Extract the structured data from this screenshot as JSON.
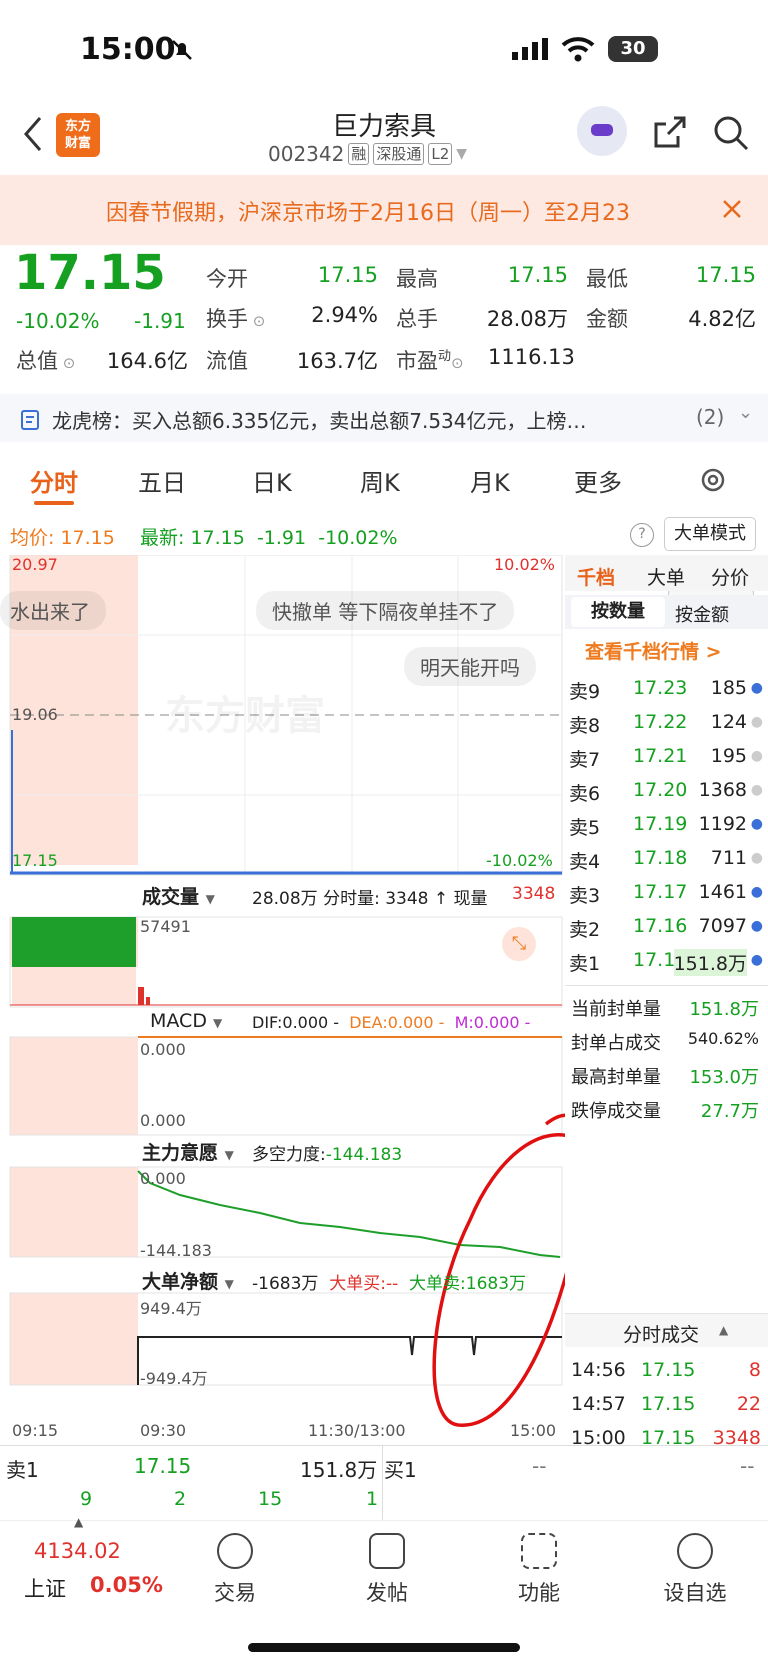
{
  "status_bar": {
    "time": "15:00",
    "battery": "30"
  },
  "header": {
    "title": "巨力索具",
    "code": "002342",
    "tags": [
      "融",
      "深股通",
      "L2"
    ],
    "logo_line1": "东方",
    "logo_line2": "财富"
  },
  "notice": {
    "text": "因春节假期，沪深京市场于2月16日（周一）至2月23"
  },
  "quote": {
    "price": "17.15",
    "change_pct": "-10.02%",
    "change": "-1.91",
    "open_label": "今开",
    "open": "17.15",
    "high_label": "最高",
    "high": "17.15",
    "low_label": "最低",
    "low": "17.15",
    "turnover_label": "换手",
    "turnover": "2.94%",
    "volume_label": "总手",
    "volume": "28.08万",
    "amount_label": "金额",
    "amount": "4.82亿",
    "mktcap_label": "总值",
    "mktcap": "164.6亿",
    "float_label": "流值",
    "float": "163.7亿",
    "pe_label": "市盈",
    "pe_sup": "动",
    "pe": "1116.13",
    "more": "更多"
  },
  "lhb": {
    "text": "龙虎榜：买入总额6.335亿元，卖出总额7.534亿元，上榜…",
    "count": "(2)"
  },
  "tabs": [
    "分时",
    "五日",
    "日K",
    "周K",
    "月K",
    "更多"
  ],
  "avg_bar": {
    "avg_label": "均价:",
    "avg": "17.15",
    "latest_label": "最新:",
    "latest": "17.15",
    "chg": "-1.91",
    "pct": "-10.02%",
    "mode": "大单模式"
  },
  "chart": {
    "top_price": "20.97",
    "top_pct": "10.02%",
    "mid_price": "19.06",
    "bot_price": "17.15",
    "bot_pct": "-10.02%",
    "watermark": "东方财富",
    "comments": [
      "水出来了",
      "快撤单 等下隔夜单挂不了",
      "明天能开吗"
    ],
    "vol_label": "成交量",
    "vol_info": "28.08万 分时量: 3348 ↑ 现量",
    "vol_now": "3348",
    "vol_max": "57491",
    "macd_label": "MACD",
    "dif": "DIF:0.000 -",
    "dea": "DEA:0.000 -",
    "m": "M:0.000 -",
    "macd_top": "0.000",
    "macd_bot": "0.000",
    "zl_label": "主力意愿",
    "zl_info_label": "多空力度:",
    "zl_info": "-144.183",
    "zl_top": "0.000",
    "zl_bot": "-144.183",
    "dd_label": "大单净额",
    "dd_val": "-1683万",
    "dd_buy": "大单买:--",
    "dd_sell": "大单卖:1683万",
    "dd_top": "949.4万",
    "dd_bot": "-949.4万",
    "times": [
      "09:15",
      "09:30",
      "11:30/13:00",
      "15:00"
    ]
  },
  "book": {
    "tabs": [
      "千档",
      "大单",
      "分价"
    ],
    "subtabs": [
      "按数量",
      "按金额"
    ],
    "link": "查看千档行情 >",
    "asks": [
      {
        "label": "卖9",
        "price": "17.23",
        "vol": "185"
      },
      {
        "label": "卖8",
        "price": "17.22",
        "vol": "124"
      },
      {
        "label": "卖7",
        "price": "17.21",
        "vol": "195"
      },
      {
        "label": "卖6",
        "price": "17.20",
        "vol": "1368"
      },
      {
        "label": "卖5",
        "price": "17.19",
        "vol": "1192"
      },
      {
        "label": "卖4",
        "price": "17.18",
        "vol": "711"
      },
      {
        "label": "卖3",
        "price": "17.17",
        "vol": "1461"
      },
      {
        "label": "卖2",
        "price": "17.16",
        "vol": "7097"
      },
      {
        "label": "卖1",
        "price": "17.15",
        "vol": "151.8万"
      }
    ],
    "stats": [
      {
        "label": "当前封单量",
        "value": "151.8万"
      },
      {
        "label": "封单占成交",
        "value": "540.62%"
      },
      {
        "label": "最高封单量",
        "value": "153.0万"
      },
      {
        "label": "跌停成交量",
        "value": "27.7万"
      }
    ],
    "trades_title": "分时成交",
    "trades": [
      {
        "time": "14:56",
        "price": "17.15",
        "vol": "8"
      },
      {
        "time": "14:57",
        "price": "17.15",
        "vol": "22"
      },
      {
        "time": "15:00",
        "price": "17.15",
        "vol": "3348"
      }
    ]
  },
  "bottom": {
    "sell_label": "卖1",
    "sell_price": "17.15",
    "sell_vol": "151.8万",
    "buy_label": "买1",
    "buy_price": "--",
    "buy_vol": "--",
    "q": [
      "9",
      "2",
      "15",
      "1"
    ]
  },
  "nav": {
    "index_val": "4134.02",
    "index_name": "上证",
    "index_pct": "0.05%",
    "items": [
      "交易",
      "发帖",
      "功能",
      "设自选"
    ]
  }
}
